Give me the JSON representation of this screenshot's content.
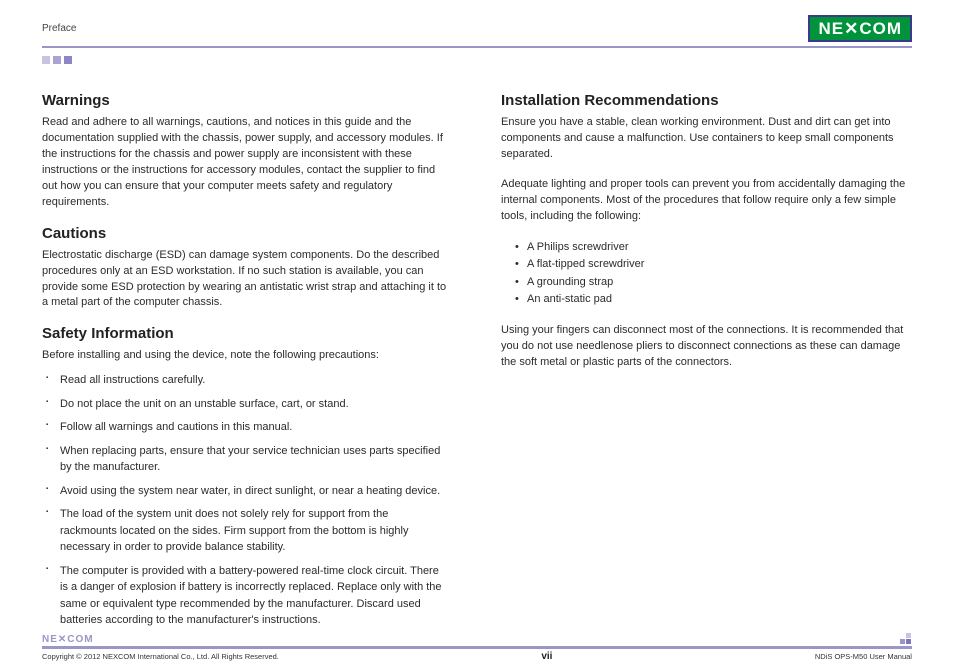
{
  "header": {
    "section": "Preface",
    "logo_text": "NE COM",
    "logo_x": "✕"
  },
  "left": {
    "warnings": {
      "title": "Warnings",
      "body": "Read and adhere to all warnings, cautions, and notices in this guide and the documentation supplied with the chassis, power supply, and accessory modules. If the instructions for the chassis and power supply are inconsistent  with these instructions or the instructions for accessory modules, contact the supplier to find out how you can ensure that your computer meets safety and regulatory requirements."
    },
    "cautions": {
      "title": "Cautions",
      "body": "Electrostatic discharge (ESD) can damage system components. Do the described procedures only at an ESD workstation. If no such station is available, you can provide some ESD protection by wearing an antistatic wrist strap and attaching it to a metal part of the computer chassis."
    },
    "safety": {
      "title": "Safety Information",
      "intro": "Before installing and using the device, note the following precautions:",
      "items": [
        "Read all instructions carefully.",
        "Do not place the unit on an unstable surface, cart, or stand.",
        "Follow all warnings and cautions in this manual.",
        "When replacing parts, ensure that your service technician uses parts specified by the manufacturer.",
        "Avoid using the system near water, in direct sunlight, or near a heating device.",
        "The load of the system unit does not solely rely for support from the rackmounts located on the sides. Firm support from the bottom is highly necessary in order to provide balance stability.",
        "The computer is provided with a battery-powered real-time clock circuit. There is a danger of explosion if battery is incorrectly replaced. Replace only with the same or equivalent type recommended by the manufacturer. Discard used batteries according to the manufacturer's instructions."
      ]
    }
  },
  "right": {
    "install": {
      "title": "Installation Recommendations",
      "p1": "Ensure you have a stable, clean working environment. Dust and dirt can get into components and cause a malfunction. Use containers to keep small components separated.",
      "p2": "Adequate lighting and proper tools can prevent you from accidentally damaging the internal components. Most of the procedures that follow require only a few simple tools, including the following:",
      "tools": [
        "A Philips screwdriver",
        "A flat-tipped screwdriver",
        "A grounding strap",
        "An anti-static pad"
      ],
      "p3": "Using your fingers can disconnect most of the connections. It is recommended that you do not use needlenose pliers to disconnect connections as these can damage the soft metal or plastic parts of the connectors."
    }
  },
  "footer": {
    "logo_small": "NE✕COM",
    "copyright": "Copyright © 2012 NEXCOM International Co., Ltd. All Rights Reserved.",
    "page": "vii",
    "doc": "NDiS OPS-M50 User Manual"
  }
}
